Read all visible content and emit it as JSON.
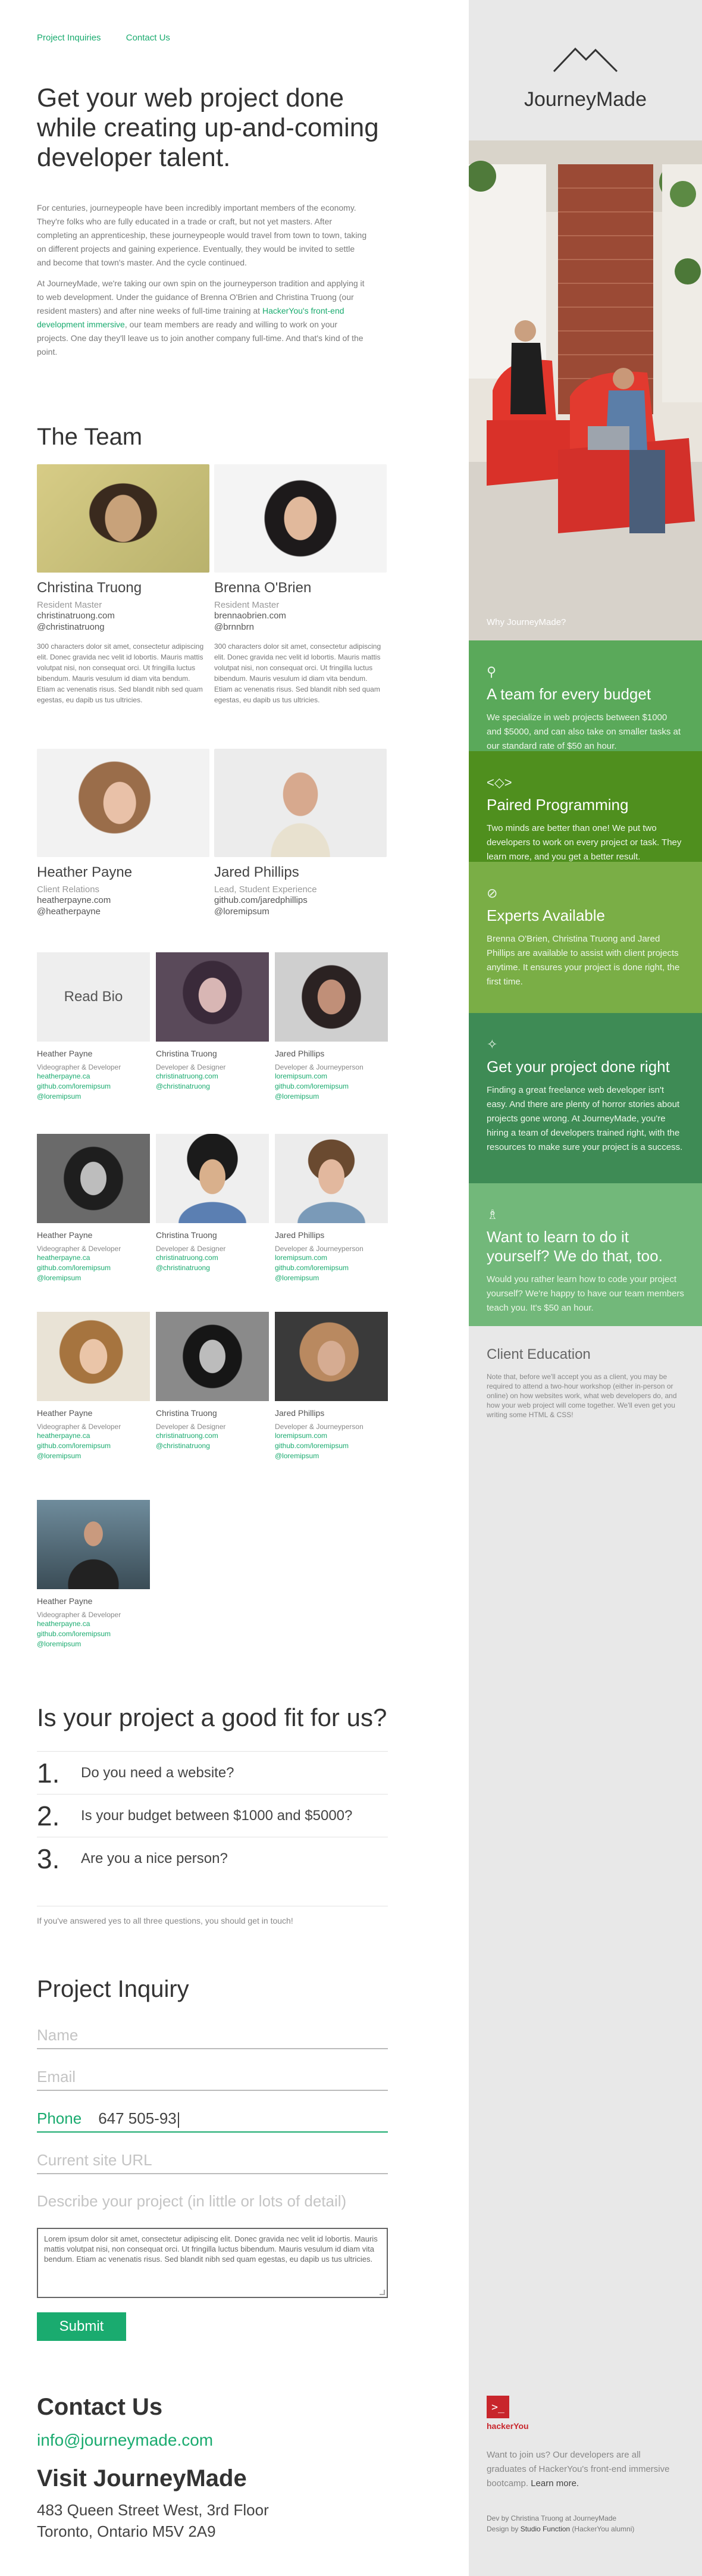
{
  "nav": {
    "inquiries": "Project Inquiries",
    "contact": "Contact Us"
  },
  "hero": {
    "title": "Get your web project done while creating up-and-coming developer talent.",
    "p1": "For centuries, journeypeople have been incredibly important members of the economy. They're folks who are fully educated in a trade or craft, but not yet masters. After completing an apprenticeship, these journeypeople would travel from town to town, taking on different projects and gaining experience. Eventually, they would be invited to settle and become that town's master. And the cycle continued.",
    "p2_a": "At JourneyMade, we're taking our own spin on the journeyperson tradition and applying it to web development. Under the guidance of Brenna O'Brien and Christina Truong (our resident masters) and after nine weeks of full-time training at ",
    "p2_link": "HackerYou's front-end development immersive",
    "p2_b": ", our team members are ready and willing to work on your projects. One day they'll leave us to join another company full-time. And that's kind of the point."
  },
  "team": {
    "title": "The Team",
    "leads": [
      {
        "name": "Christina Truong",
        "role": "Resident Master",
        "site": "christinatruong.com",
        "handle": "@christinatruong",
        "bio": "300 characters dolor sit amet, consectetur adipiscing elit. Donec gravida nec velit id lobortis. Mauris mattis volutpat nisi, non consequat orci. Ut fringilla luctus bibendum. Mauris vesulum id diam vita bendum. Etiam ac venenatis risus. Sed blandit nibh sed quam egestas, eu dapib us tus ultricies."
      },
      {
        "name": "Brenna O'Brien",
        "role": "Resident Master",
        "site": "brennaobrien.com",
        "handle": "@brnnbrn",
        "bio": "300 characters dolor sit amet, consectetur adipiscing elit. Donec gravida nec velit id lobortis. Mauris mattis volutpat nisi, non consequat orci. Ut fringilla luctus bibendum. Mauris vesulum id diam vita bendum. Etiam ac venenatis risus. Sed blandit nibh sed quam egestas, eu dapib us tus ultricies."
      },
      {
        "name": "Heather Payne",
        "role": "Client Relations",
        "site": "heatherpayne.com",
        "handle": "@heatherpayne"
      },
      {
        "name": "Jared Phillips",
        "role": "Lead, Student Experience",
        "site": "github.com/jaredphillips",
        "handle": "@loremipsum"
      }
    ],
    "read_bio": "Read Bio",
    "members": [
      {
        "name": "Heather Payne",
        "role": "Videographer & Developer",
        "l1": "heatherpayne.ca",
        "l2": "github.com/loremipsum",
        "l3": "@loremipsum"
      },
      {
        "name": "Christina Truong",
        "role": "Developer & Designer",
        "l1": "christinatruong.com",
        "l2": "@christinatruong",
        "l3": ""
      },
      {
        "name": "Jared Phillips",
        "role": "Developer & Journeyperson",
        "l1": "loremipsum.com",
        "l2": "github.com/loremipsum",
        "l3": "@loremipsum"
      },
      {
        "name": "Heather Payne",
        "role": "Videographer & Developer",
        "l1": "heatherpayne.ca",
        "l2": "github.com/loremipsum",
        "l3": "@loremipsum"
      },
      {
        "name": "Christina Truong",
        "role": "Developer & Designer",
        "l1": "christinatruong.com",
        "l2": "@christinatruong",
        "l3": ""
      },
      {
        "name": "Jared Phillips",
        "role": "Developer & Journeyperson",
        "l1": "loremipsum.com",
        "l2": "github.com/loremipsum",
        "l3": "@loremipsum"
      },
      {
        "name": "Heather Payne",
        "role": "Videographer & Developer",
        "l1": "heatherpayne.ca",
        "l2": "github.com/loremipsum",
        "l3": "@loremipsum"
      },
      {
        "name": "Christina Truong",
        "role": "Developer & Designer",
        "l1": "christinatruong.com",
        "l2": "@christinatruong",
        "l3": ""
      },
      {
        "name": "Jared Phillips",
        "role": "Developer & Journeyperson",
        "l1": "loremipsum.com",
        "l2": "github.com/loremipsum",
        "l3": "@loremipsum"
      },
      {
        "name": "Heather Payne",
        "role": "Videographer & Developer",
        "l1": "heatherpayne.ca",
        "l2": "github.com/loremipsum",
        "l3": "@loremipsum"
      }
    ]
  },
  "fit": {
    "title": "Is your project a good fit for us?",
    "items": [
      {
        "num": "1.",
        "q": "Do you need a website?"
      },
      {
        "num": "2.",
        "q": "Is your budget between $1000 and $5000?"
      },
      {
        "num": "3.",
        "q": "Are you a nice person?"
      }
    ],
    "note": "If you've answered yes to all three questions, you should get in touch!"
  },
  "inquiry": {
    "title": "Project Inquiry",
    "name_ph": "Name",
    "email_ph": "Email",
    "phone_label": "Phone",
    "phone_value": "647 505-93",
    "url_ph": "Current site URL",
    "describe_ph": "Describe your project (in little or lots of detail)",
    "describe_value": "Lorem ipsum dolor sit amet, consectetur adipiscing elit. Donec gravida nec velit id lobortis. Mauris mattis volutpat nisi, non consequat orci. Ut fringilla luctus bibendum. Mauris vesulum id diam vita bendum. Etiam ac venenatis risus. Sed blandit nibh sed quam egestas, eu dapib us tus ultricies.",
    "submit": "Submit"
  },
  "contact": {
    "title": "Contact Us",
    "email": "info@journeymade.com",
    "visit_title": "Visit JourneyMade",
    "addr1": "483 Queen Street West, 3rd Floor",
    "addr2": "Toronto, Ontario M5V 2A9"
  },
  "sidebar": {
    "logo": "JourneyMade",
    "why": "Why JourneyMade?",
    "panels": [
      {
        "icon": "⚲",
        "title": "A team for every budget",
        "text": "We specialize in web projects between $1000 and $5000, and can also take on smaller tasks at our standard rate of $50 an hour.",
        "color": "#5aa95a"
      },
      {
        "icon": "<◇>",
        "title": "Paired Programming",
        "text": "Two minds are better than one! We put two developers to work on every project or task. They learn more, and you get a better result.",
        "color": "#4f8f1e"
      },
      {
        "icon": "⊘",
        "title": "Experts Available",
        "text": "Brenna O'Brien, Christina Truong and Jared Phillips are available to assist with client projects anytime. It ensures your project is done right, the first time.",
        "color": "#7aae46"
      },
      {
        "icon": "✧",
        "title": "Get your project done right",
        "text": "Finding a great freelance web developer isn't easy. And there are plenty of horror stories about projects gone wrong. At JourneyMade, you're hiring a team of developers trained right, with the resources to make sure your project is a success.",
        "color": "#3e8b55"
      },
      {
        "icon": "♗",
        "title": "Want to learn to do it yourself? We do that, too.",
        "text": "Would you rather learn how to code your project yourself? We're happy to have our team members teach you. It's $50 an hour.",
        "color": "#72b87a"
      }
    ],
    "edu_title": "Client Education",
    "edu_text": "Note that, before we'll accept you as a client, you may be required to attend a two-hour workshop (either in-person or online) on how websites work, what web developers do, and how your web project will come together. We'll even get you writing some HTML & CSS!",
    "hy_name": "hackerYou",
    "hy_text": "Want to join us? Our developers are all graduates of HackerYou's front-end immersive bootcamp.",
    "hy_learn": "Learn more.",
    "credit1": "Dev by Christina Truong at JourneyMade",
    "credit2_a": "Design by ",
    "credit2_b": "Studio Function",
    "credit2_c": " (HackerYou alumni)"
  }
}
